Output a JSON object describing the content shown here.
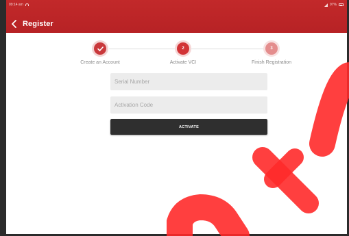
{
  "status_bar": {
    "time": "09:14 am",
    "battery": "97%"
  },
  "header": {
    "title": "Register",
    "back_icon": "chevron-left-icon"
  },
  "stepper": {
    "steps": [
      {
        "label": "Create an Account",
        "number": "",
        "state": "done"
      },
      {
        "label": "Activate VCI",
        "number": "2",
        "state": "active"
      },
      {
        "label": "Finish Registration",
        "number": "3",
        "state": "pending"
      }
    ]
  },
  "form": {
    "serial_placeholder": "Serial Number",
    "serial_value": "",
    "code_placeholder": "Activation Code",
    "code_value": "",
    "activate_label": "ACTIVATE"
  },
  "watermark": {
    "text": "nkc"
  },
  "colors": {
    "header_red": "#b72225",
    "step_red": "#d23336",
    "button_dark": "#2f2f2f",
    "watermark_red": "#ff2a2a"
  }
}
